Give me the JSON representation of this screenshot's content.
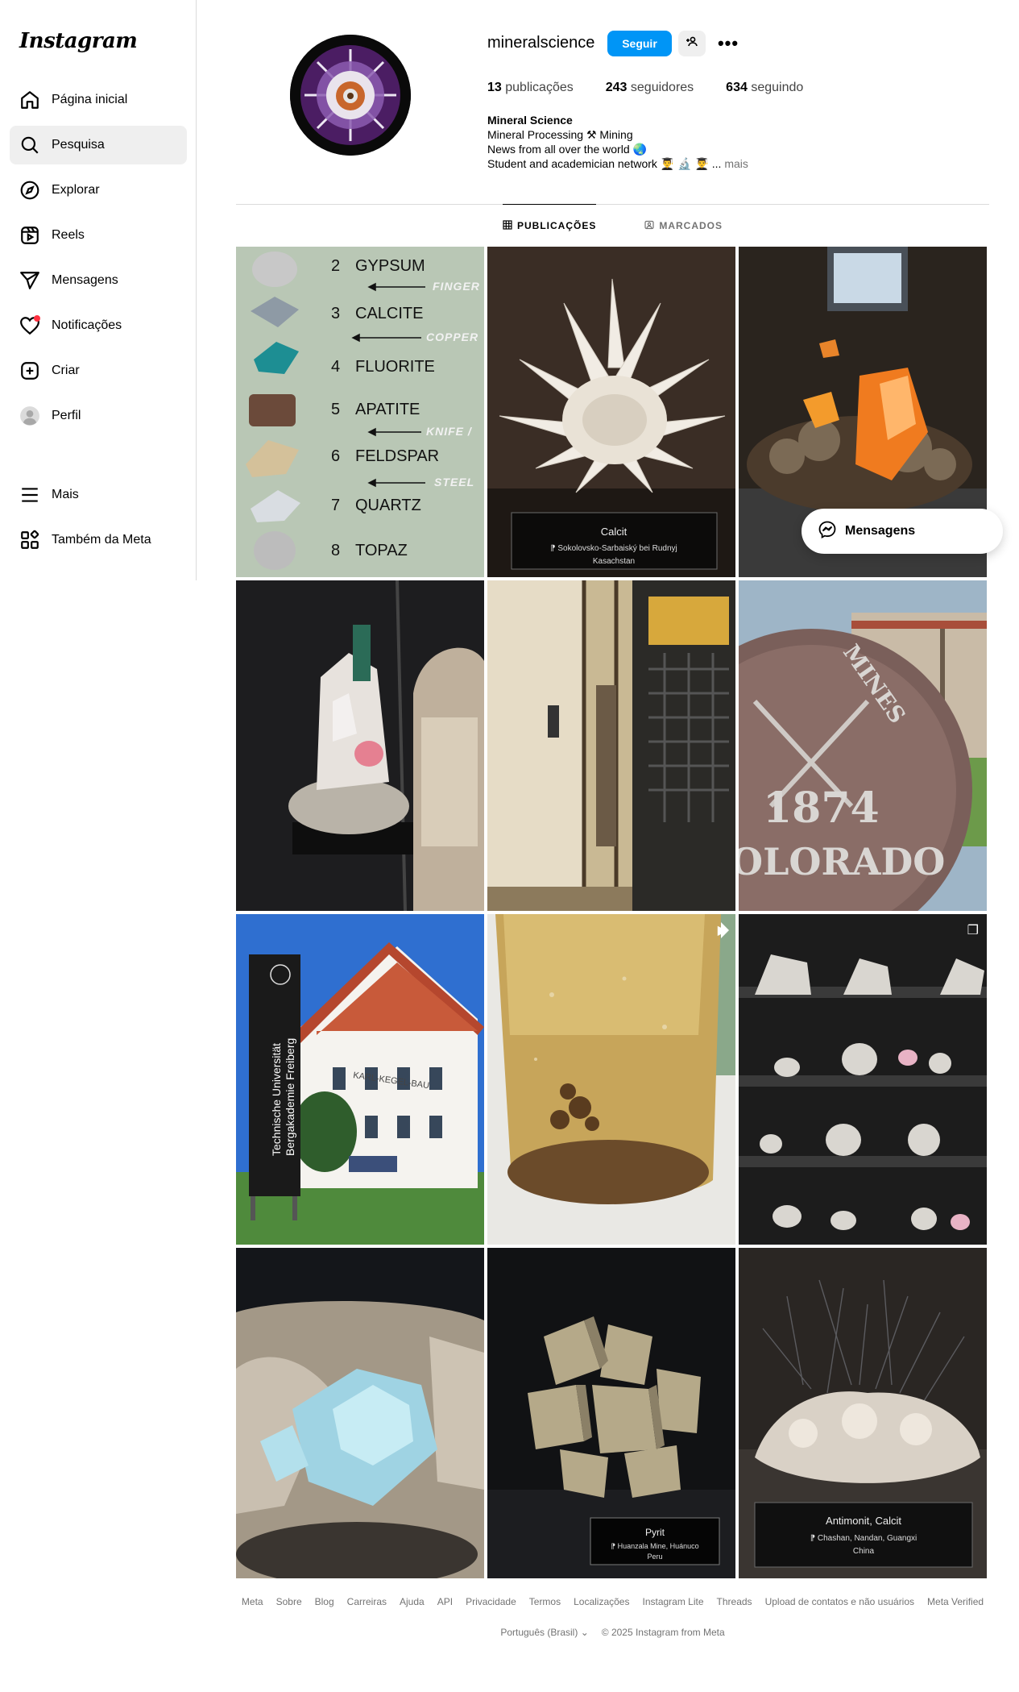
{
  "app": {
    "logo": "Instagram"
  },
  "sidebar": {
    "items": [
      {
        "label": "Página inicial",
        "icon": "home-icon"
      },
      {
        "label": "Pesquisa",
        "icon": "search-icon"
      },
      {
        "label": "Explorar",
        "icon": "compass-icon"
      },
      {
        "label": "Reels",
        "icon": "reels-icon"
      },
      {
        "label": "Mensagens",
        "icon": "send-icon"
      },
      {
        "label": "Notificações",
        "icon": "heart-icon"
      },
      {
        "label": "Criar",
        "icon": "plus-square-icon"
      },
      {
        "label": "Perfil",
        "icon": "profile-icon"
      }
    ],
    "bottom_items": [
      {
        "label": "Mais",
        "icon": "menu-icon"
      },
      {
        "label": "Também da Meta",
        "icon": "meta-apps-icon"
      }
    ]
  },
  "profile": {
    "username": "mineralscience",
    "follow_label": "Seguir",
    "stats": {
      "posts_count": "13",
      "posts_label": " publicações",
      "followers_count": "243",
      "followers_label": " seguidores",
      "following_count": "634",
      "following_label": " seguindo"
    },
    "bio": {
      "name": "Mineral Science",
      "line1": "Mineral Processing ⚒ Mining",
      "line2": "News from all over the world 🌏",
      "line3": "Student and academician network 👨‍🎓 🔬 👨‍🎓 ...",
      "more": " mais"
    }
  },
  "tabs": [
    {
      "label": "PUBLICAÇÕES",
      "icon": "grid-icon"
    },
    {
      "label": "MARCADOS",
      "icon": "tagged-icon"
    }
  ],
  "posts": {
    "p1": {
      "minerals": [
        {
          "num": "2",
          "name": "GYPSUM"
        },
        {
          "num": "3",
          "name": "CALCITE"
        },
        {
          "num": "4",
          "name": "FLUORITE"
        },
        {
          "num": "5",
          "name": "APATITE"
        },
        {
          "num": "6",
          "name": "FELDSPAR"
        },
        {
          "num": "7",
          "name": "QUARTZ"
        },
        {
          "num": "8",
          "name": "TOPAZ"
        }
      ],
      "tools": [
        "FINGER",
        "COPPER",
        "KNIFE / ",
        "STEEL"
      ]
    },
    "p2": {
      "label_title": "Calcit",
      "label_line1": "⁋ Sokolovsko-Sarbaiský bei Rudnyj",
      "label_line2": "Kasachstan"
    },
    "p6": {
      "year": "1874",
      "state": "OLORADO",
      "word": "MINES"
    },
    "p7": {
      "sign_line1": "Technische Universität",
      "sign_line2": "Bergakademie Freiberg",
      "building": "KARL-KEGEL-BAU"
    },
    "p11": {
      "label_title": "Pyrit",
      "label_line1": "⁋ Huanzala Mine, Huánuco",
      "label_line2": "Peru"
    },
    "p12": {
      "label_title": "Antimonit, Calcit",
      "label_line1": "⁋ Chashan, Nandan, Guangxi",
      "label_line2": "China"
    }
  },
  "messages_pill": {
    "label": "Mensagens"
  },
  "footer": {
    "links": [
      "Meta",
      "Sobre",
      "Blog",
      "Carreiras",
      "Ajuda",
      "API",
      "Privacidade",
      "Termos",
      "Localizações",
      "Instagram Lite",
      "Threads",
      "Upload de contatos e não usuários",
      "Meta Verified"
    ],
    "language": "Português (Brasil)",
    "copyright": "© 2025 Instagram from Meta"
  },
  "colors": {
    "accent": "#0095f6",
    "notification": "#ff3040",
    "border": "#dbdbdb"
  }
}
